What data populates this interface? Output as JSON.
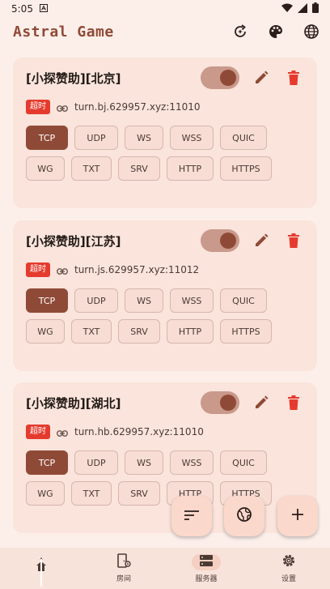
{
  "status_bar": {
    "time": "5:05"
  },
  "app_bar": {
    "title": "Astral Game"
  },
  "servers": [
    {
      "name": "[小探赞助][北京]",
      "badge": "超时",
      "address": "turn.bj.629957.xyz:11010",
      "enabled": true,
      "protocols": [
        "TCP",
        "UDP",
        "WS",
        "WSS",
        "QUIC",
        "WG",
        "TXT",
        "SRV",
        "HTTP",
        "HTTPS"
      ],
      "selected": "TCP"
    },
    {
      "name": "[小探赞助][江苏]",
      "badge": "超时",
      "address": "turn.js.629957.xyz:11012",
      "enabled": true,
      "protocols": [
        "TCP",
        "UDP",
        "WS",
        "WSS",
        "QUIC",
        "WG",
        "TXT",
        "SRV",
        "HTTP",
        "HTTPS"
      ],
      "selected": "TCP"
    },
    {
      "name": "[小探赞助][湖北]",
      "badge": "超时",
      "address": "turn.hb.629957.xyz:11010",
      "enabled": true,
      "protocols": [
        "TCP",
        "UDP",
        "WS",
        "WSS",
        "QUIC",
        "WG",
        "TXT",
        "SRV",
        "HTTP",
        "HTTPS"
      ],
      "selected": "TCP"
    }
  ],
  "bottom_nav": {
    "items": [
      {
        "label": "",
        "icon": "home-icon"
      },
      {
        "label": "房间",
        "icon": "room-icon"
      },
      {
        "label": "服务器",
        "icon": "server-icon"
      },
      {
        "label": "设置",
        "icon": "settings-icon"
      }
    ],
    "active": 2
  },
  "colors": {
    "accent": "#8f4a37",
    "badge": "#e53b2e",
    "delete": "#e53b2e",
    "card": "#fae4dc",
    "background": "#fcefea"
  }
}
